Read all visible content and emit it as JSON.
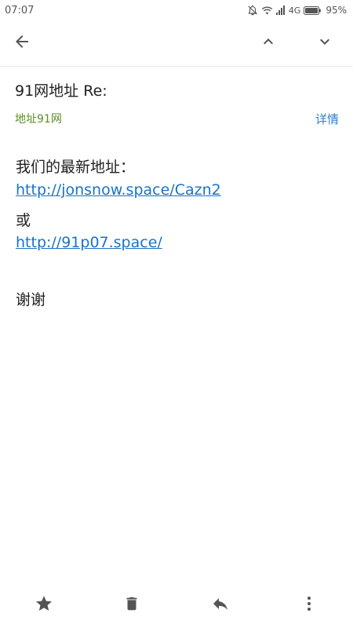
{
  "status_bar": {
    "time": "07:07",
    "network": "4G",
    "battery": "95%"
  },
  "app_bar": {
    "icons": [
      "arrow-left-icon",
      "chevron-up-icon",
      "chevron-down-icon"
    ]
  },
  "email": {
    "subject": "91网地址 Re:",
    "sender": "地址91网",
    "details_label": "详情",
    "body": {
      "line1": "我们的最新地址：",
      "link1": "http://jonsnow.space/Cazn2",
      "line3": "或",
      "link2": "http://91p07.space/",
      "line5": "谢谢"
    }
  },
  "bottom_bar": {
    "icons": [
      "star-icon",
      "trash-icon",
      "reply-icon",
      "more-vertical-icon"
    ]
  },
  "colors": {
    "sender": "#5c8f1f",
    "link": "#1a73c8",
    "details": "#2e7ed0",
    "icon": "#555555"
  }
}
